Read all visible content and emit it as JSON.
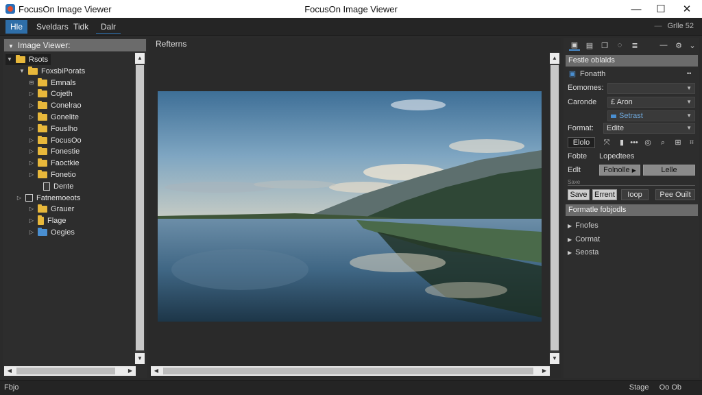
{
  "window": {
    "title_left": "FocusOn Image Viewer",
    "title_center": "FocusOn Image Viewer",
    "minimize_glyph": "—",
    "maximize_glyph": "☐",
    "close_glyph": "✕"
  },
  "menubar": {
    "items": [
      "Hle",
      "Sveldars",
      "Tidk",
      "Dalr"
    ],
    "right_text": "Grlle 52"
  },
  "left_panel": {
    "header": "Image Viewer:",
    "tree": [
      {
        "label": "Rsots",
        "icon": "folder-icon",
        "toggle": "▼"
      },
      {
        "label": "FoxsbiPorats",
        "icon": "folder-icon",
        "toggle": "▼"
      },
      {
        "label": "Emnals",
        "icon": "folder-icon",
        "toggle": "⊟"
      },
      {
        "label": "Cojeth",
        "icon": "folder-icon",
        "toggle": "▷"
      },
      {
        "label": "Conelrao",
        "icon": "folder-icon",
        "toggle": "▷"
      },
      {
        "label": "Gonelite",
        "icon": "folder-icon",
        "toggle": "▷"
      },
      {
        "label": "Fouslho",
        "icon": "folder-icon",
        "toggle": "▷"
      },
      {
        "label": "FocusOo",
        "icon": "folder-icon",
        "toggle": "▷"
      },
      {
        "label": "Fonestie",
        "icon": "folder-icon",
        "toggle": "▷"
      },
      {
        "label": "Faoctkie",
        "icon": "folder-icon",
        "toggle": "▷"
      },
      {
        "label": "Fonetio",
        "icon": "folder-icon",
        "toggle": "▷"
      },
      {
        "label": "Dente",
        "icon": "document-icon",
        "toggle": ""
      },
      {
        "label": "Fatnemoeots",
        "icon": "box-icon",
        "toggle": "▷"
      },
      {
        "label": "Grauer",
        "icon": "folder-icon",
        "toggle": "▷"
      },
      {
        "label": "Flage",
        "icon": "file-icon",
        "toggle": "▷"
      },
      {
        "label": "Oegies",
        "icon": "folder-icon-blue",
        "toggle": "▷"
      }
    ]
  },
  "center": {
    "title": "Refterns"
  },
  "right_panel": {
    "section1": "Festle oblalds",
    "format_row": "Fonatth",
    "more_glyph": "••",
    "row_comomes_label": "Eomomes:",
    "row_comomes_value": "",
    "row_caronde_label": "Caronde",
    "row_caronde_value": "£ Aron",
    "row_sub_value": "Setrast",
    "row_format_label": "Format:",
    "row_format_value": "Edite",
    "slider_button": "Elolo",
    "fobte_label": "Fobte",
    "fobte_value": "Lopedtees",
    "edit_label": "Edlt",
    "edit_value1": "Folnolle",
    "edit_value2": "Lelle",
    "small_caption": "Saxe",
    "btn_save": "Save",
    "btn_errent": "Errent",
    "btn_loop": "Ioop",
    "btn_peceult": "Pee Ouilt",
    "section2": "Formatle fobjodls",
    "collapsible": [
      "Fnofes",
      "Cormat",
      "Seosta"
    ]
  },
  "statusbar": {
    "left": "Fbjo",
    "right1": "Stage",
    "right2": "Oo Ob"
  },
  "colors": {
    "accent": "#2e6ea8",
    "folder": "#e8b83b",
    "panel_header": "#6b6b6b"
  }
}
